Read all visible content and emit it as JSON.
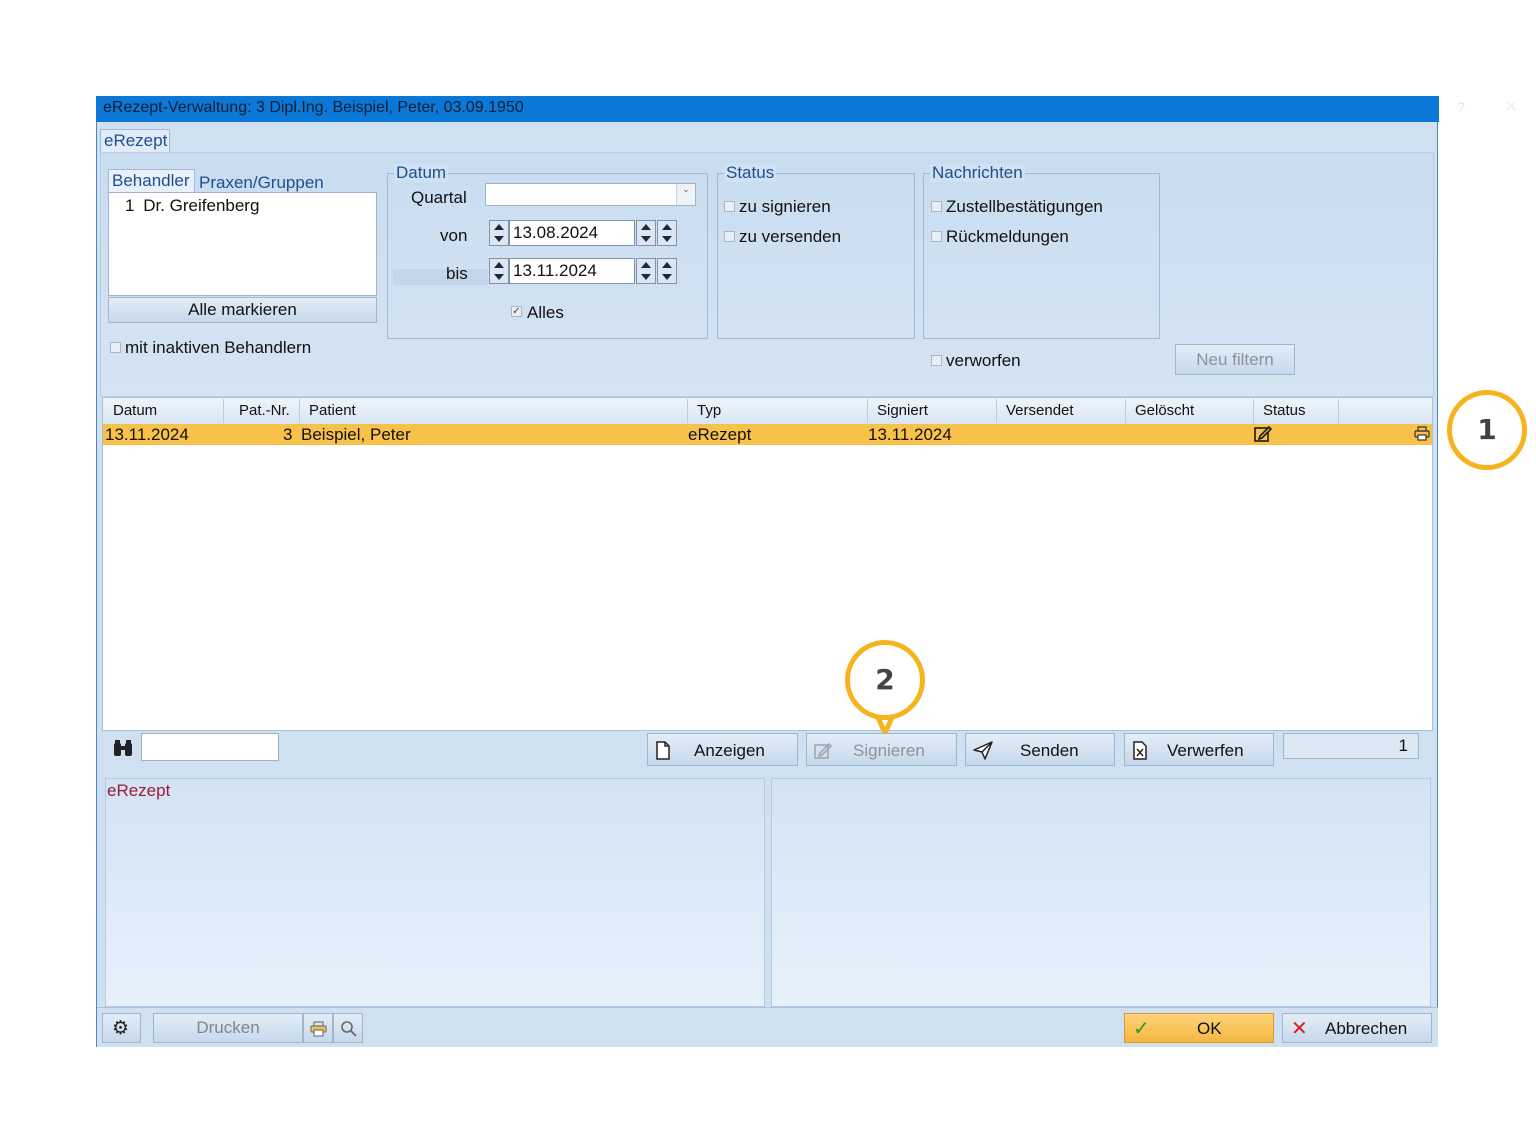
{
  "window": {
    "title": "eRezept-Verwaltung: 3 Dipl.Ing. Beispiel, Peter, 03.09.1950",
    "help": "?",
    "close": "✕",
    "tab": "eRezept"
  },
  "behandler": {
    "tab_active": "Behandler",
    "tab_other": "Praxen/Gruppen",
    "items": [
      {
        "num": "1",
        "name": "Dr. Greifenberg"
      }
    ],
    "mark_all": "Alle markieren",
    "inactive_label": "mit inaktiven Behandlern"
  },
  "datum": {
    "legend": "Datum",
    "quartal_label": "Quartal",
    "quartal_value": "",
    "von_label": "von",
    "von_value": "13.08.2024",
    "bis_label": "bis",
    "bis_value": "13.11.2024",
    "alles_label": "Alles",
    "alles_checked": true
  },
  "status": {
    "legend": "Status",
    "options": [
      "zu signieren",
      "zu versenden"
    ]
  },
  "nachrichten": {
    "legend": "Nachrichten",
    "options": [
      "Zustellbestätigungen",
      "Rückmeldungen"
    ],
    "verworfen": "verworfen"
  },
  "neu_filtern": "Neu filtern",
  "table": {
    "columns": [
      "Datum",
      "Pat.-Nr.",
      "Patient",
      "Typ",
      "Signiert",
      "Versendet",
      "Gelöscht",
      "Status"
    ],
    "rows": [
      {
        "datum": "13.11.2024",
        "patnr": "3",
        "patient": "Beispiel, Peter",
        "typ": "eRezept",
        "signiert": "13.11.2024",
        "versendet": "",
        "geloescht": "",
        "status_icon": "edit-icon",
        "print_icon": "printer-icon"
      }
    ]
  },
  "search": {
    "value": ""
  },
  "actions": {
    "anzeigen": "Anzeigen",
    "signieren": "Signieren",
    "senden": "Senden",
    "verwerfen": "Verwerfen",
    "count": "1"
  },
  "detail": {
    "title": "eRezept",
    "title_color": "#9b1b3c"
  },
  "footer": {
    "drucken": "Drucken",
    "ok": "OK",
    "abbrechen": "Abbrechen"
  },
  "callouts": [
    "1",
    "2"
  ],
  "colors": {
    "accent": "#f5b41f",
    "titlebar": "#0b78d7",
    "selected_row": "#f7c14a"
  }
}
